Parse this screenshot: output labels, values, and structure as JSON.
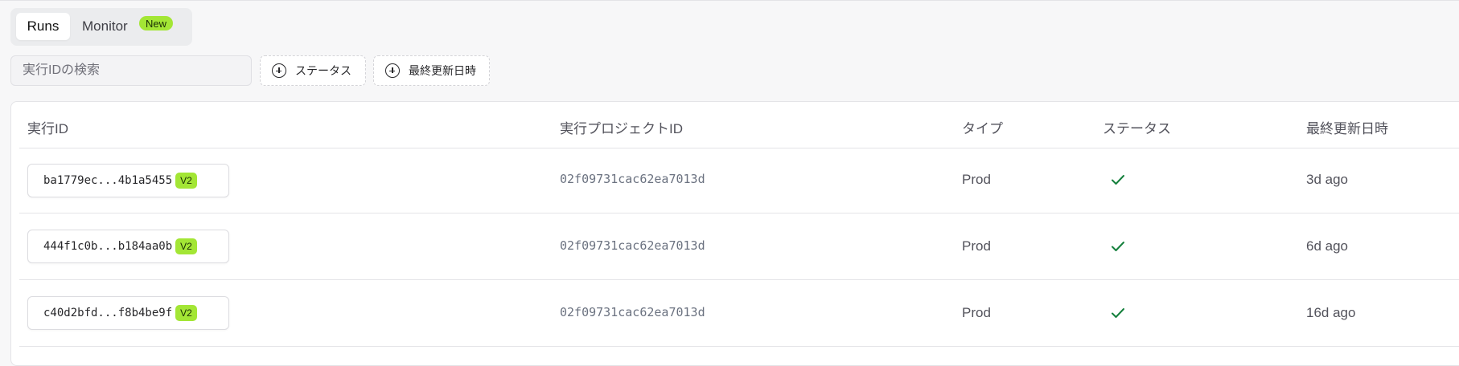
{
  "tabs": {
    "runs_label": "Runs",
    "monitor_label": "Monitor",
    "new_badge": "New"
  },
  "filters": {
    "search_placeholder": "実行IDの検索",
    "status_label": "ステータス",
    "updated_label": "最終更新日時"
  },
  "table": {
    "headers": {
      "run_id": "実行ID",
      "project_id": "実行プロジェクトID",
      "type": "タイプ",
      "status": "ステータス",
      "updated": "最終更新日時"
    },
    "rows": [
      {
        "run_id": "ba1779ec...4b1a5455",
        "version": "V2",
        "project_id": "02f09731cac62ea7013d",
        "type": "Prod",
        "status": "success",
        "updated": "3d ago"
      },
      {
        "run_id": "444f1c0b...b184aa0b",
        "version": "V2",
        "project_id": "02f09731cac62ea7013d",
        "type": "Prod",
        "status": "success",
        "updated": "6d ago"
      },
      {
        "run_id": "c40d2bfd...f8b4be9f",
        "version": "V2",
        "project_id": "02f09731cac62ea7013d",
        "type": "Prod",
        "status": "success",
        "updated": "16d ago"
      }
    ]
  },
  "colors": {
    "accent_badge": "#a3e635",
    "check": "#15803d"
  }
}
